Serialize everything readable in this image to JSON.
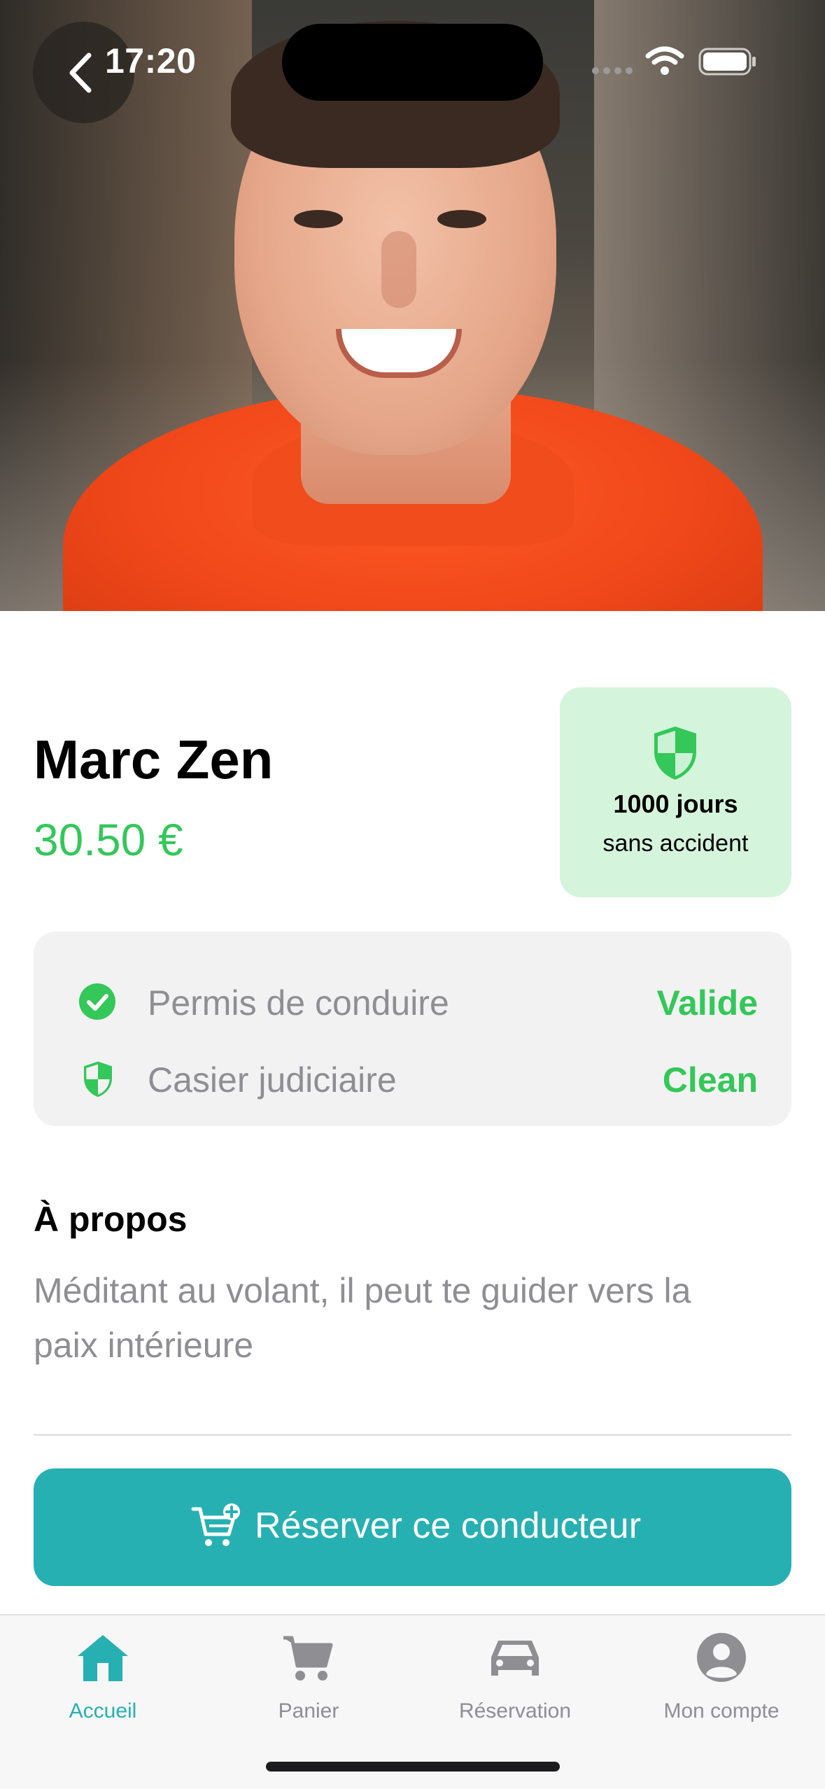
{
  "status_bar": {
    "time": "17:20"
  },
  "driver": {
    "name": "Marc Zen",
    "price": "30.50 €"
  },
  "badge": {
    "days": "1000 jours",
    "subtitle": "sans accident"
  },
  "checks": [
    {
      "label": "Permis de conduire",
      "value": "Valide",
      "icon": "checkmark-circle-icon"
    },
    {
      "label": "Casier judiciaire",
      "value": "Clean",
      "icon": "shield-icon"
    }
  ],
  "about": {
    "title": "À propos",
    "text": "Méditant au volant, il peut te guider vers la paix intérieure"
  },
  "book_button": {
    "label": "Réserver ce conducteur"
  },
  "tabs": [
    {
      "label": "Accueil",
      "icon": "home-icon",
      "active": true
    },
    {
      "label": "Panier",
      "icon": "cart-icon",
      "active": false
    },
    {
      "label": "Réservation",
      "icon": "car-icon",
      "active": false
    },
    {
      "label": "Mon compte",
      "icon": "user-icon",
      "active": false
    }
  ],
  "colors": {
    "accent": "#27b0b1",
    "success": "#34c759",
    "badge_bg": "#d4f4dc"
  }
}
